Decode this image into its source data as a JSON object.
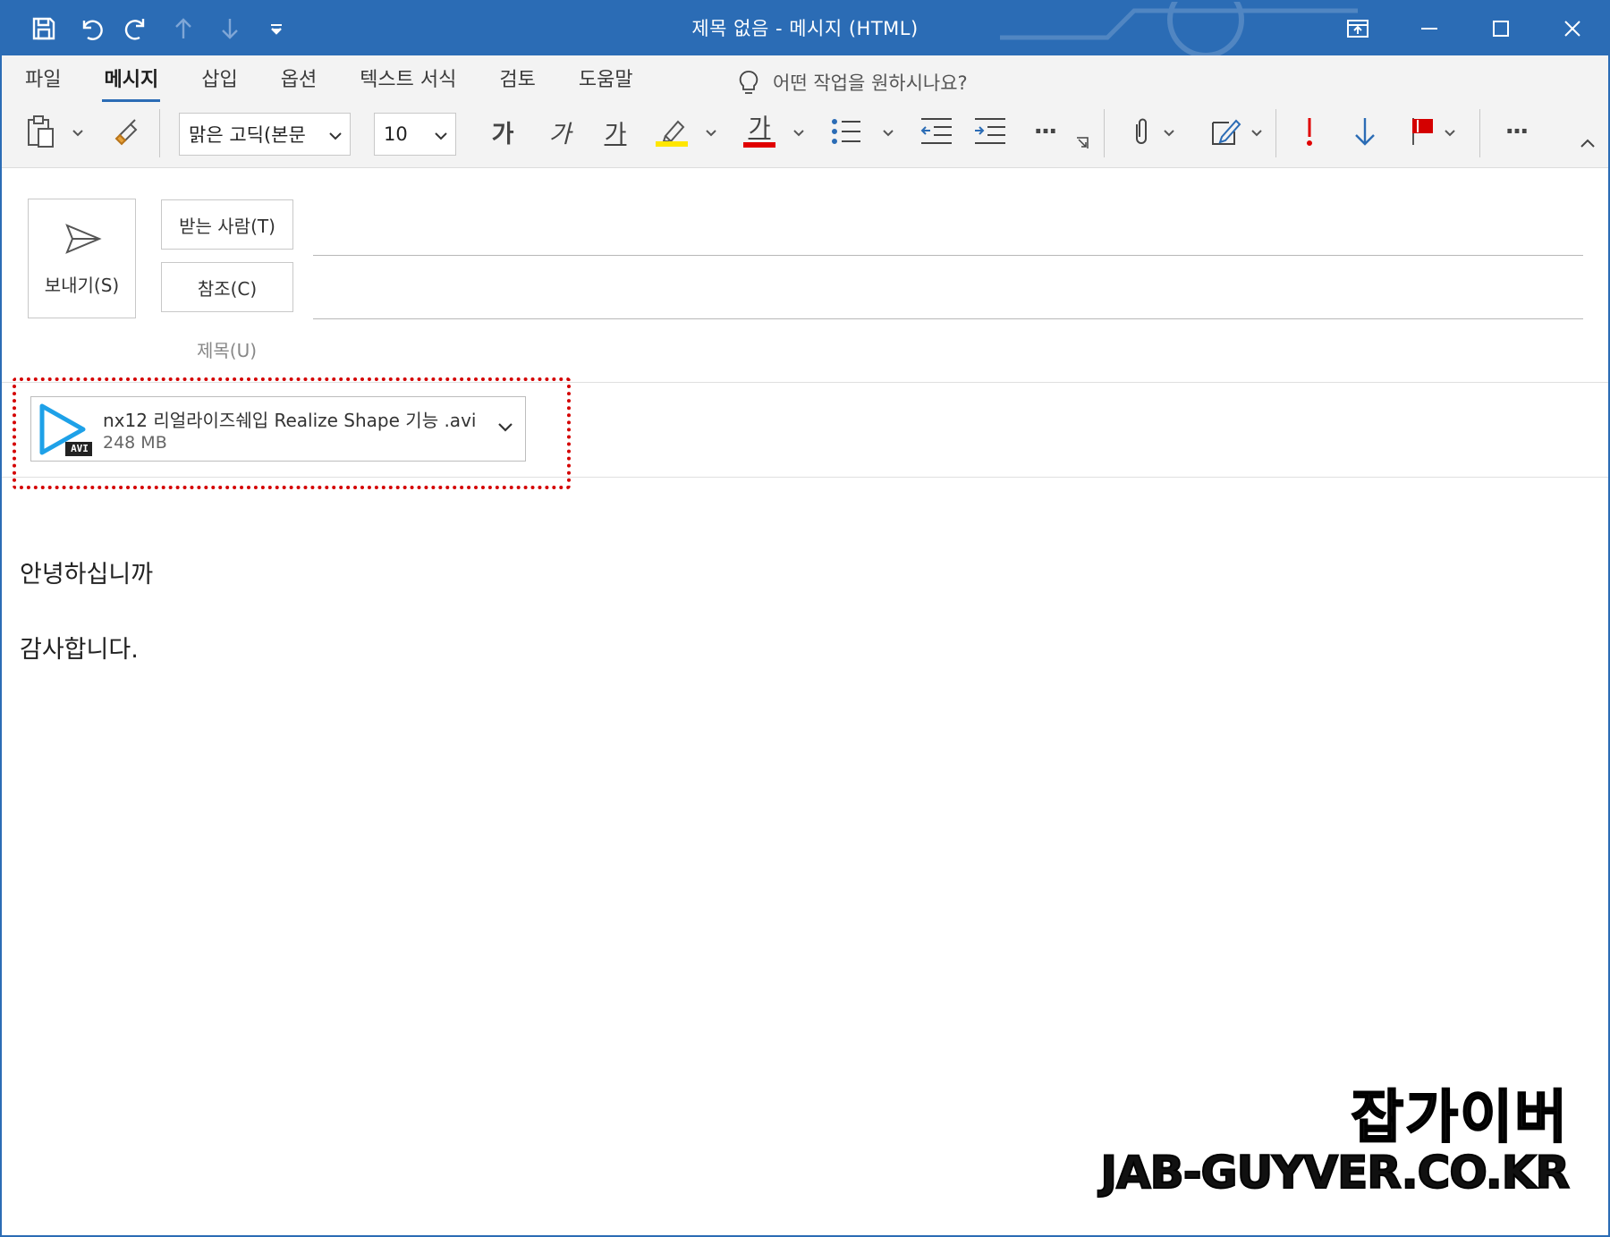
{
  "window": {
    "title": "제목 없음  -  메시지 (HTML)"
  },
  "quick_access": [
    {
      "icon": "save-icon"
    },
    {
      "icon": "undo-icon"
    },
    {
      "icon": "redo-icon"
    },
    {
      "icon": "previous-item-icon"
    },
    {
      "icon": "next-item-icon"
    },
    {
      "icon": "customize-qat-icon"
    }
  ],
  "window_controls": [
    {
      "icon": "ribbon-display-options-icon"
    },
    {
      "icon": "minimize-icon"
    },
    {
      "icon": "maximize-icon"
    },
    {
      "icon": "close-icon"
    }
  ],
  "ribbon": {
    "tabs": [
      {
        "label": "파일"
      },
      {
        "label": "메시지",
        "active": true
      },
      {
        "label": "삽입"
      },
      {
        "label": "옵션"
      },
      {
        "label": "텍스트 서식"
      },
      {
        "label": "검토"
      },
      {
        "label": "도움말"
      }
    ],
    "tell_me": "어떤 작업을 원하시나요?",
    "font_name": "맑은 고딕(본문",
    "font_size": "10",
    "bold_glyph": "가",
    "italic_glyph": "가",
    "underline_glyph": "가",
    "font_color_glyph": "가",
    "more_glyph": "···",
    "colors": {
      "highlight": "#ffe600",
      "font_color": "#e00000",
      "importance_high": "#e00000",
      "importance_low": "#2b6cb5",
      "flag": "#d40000"
    }
  },
  "header": {
    "send_label": "보내기(S)",
    "to_label": "받는 사람(T)",
    "cc_label": "참조(C)",
    "subject_label": "제목(U)"
  },
  "attachment": {
    "name": "nx12 리얼라이즈쉐입 Realize Shape 기능 .avi",
    "size": "248 MB",
    "badge": "AVI"
  },
  "body": {
    "lines": [
      "안녕하십니까",
      "감사합니다."
    ]
  },
  "watermark": {
    "korean": "잡가이버",
    "domain": "JAB-GUYVER.CO.KR"
  }
}
